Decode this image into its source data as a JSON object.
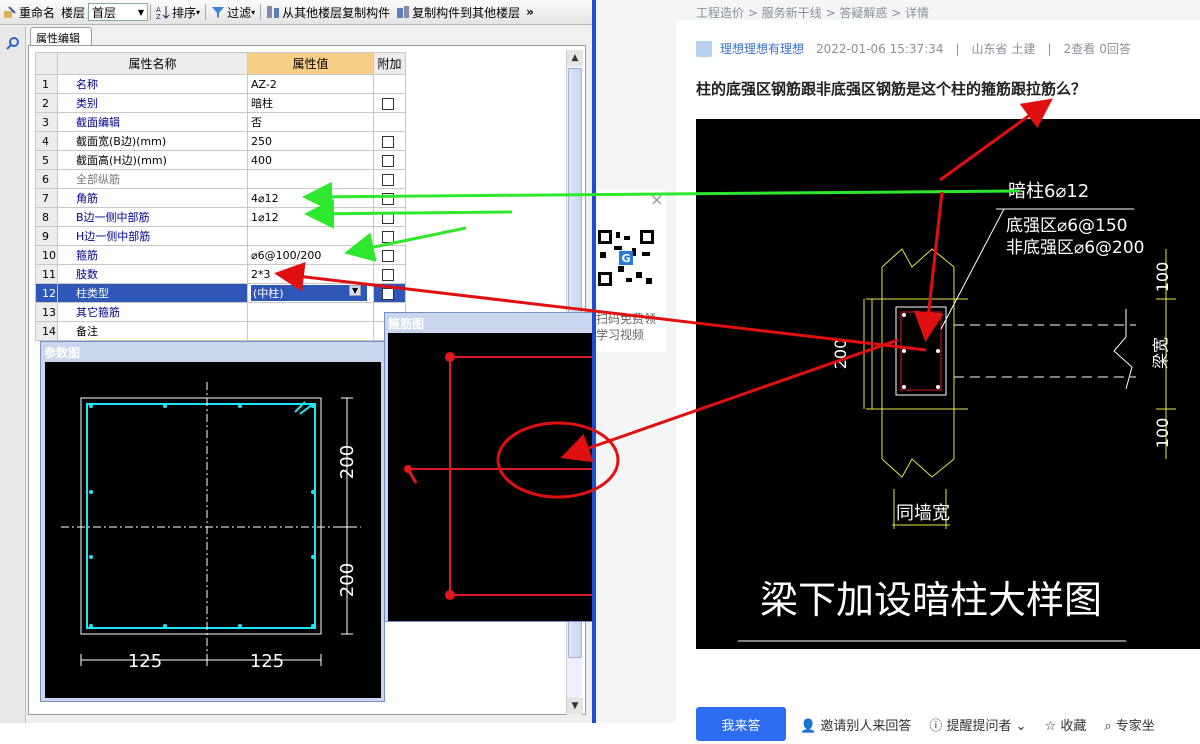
{
  "toolbar": {
    "rename": "重命名",
    "floor_label": "楼层",
    "floor_value": "首层",
    "sort": "排序",
    "filter": "过滤",
    "copy_from": "从其他楼层复制构件",
    "copy_to": "复制构件到其他楼层",
    "more": "»"
  },
  "tab": "属性编辑",
  "grid": {
    "headers": [
      "属性名称",
      "属性值",
      "附加"
    ],
    "rows": [
      {
        "no": "1",
        "name": "名称",
        "value": "AZ-2",
        "cb": false,
        "cls": ""
      },
      {
        "no": "2",
        "name": "类别",
        "value": "暗柱",
        "cb": true,
        "cls": ""
      },
      {
        "no": "3",
        "name": "截面编辑",
        "value": "否",
        "cb": false,
        "cls": ""
      },
      {
        "no": "4",
        "name": "截面宽(B边)(mm)",
        "value": "250",
        "cb": true,
        "cls": "blk"
      },
      {
        "no": "5",
        "name": "截面高(H边)(mm)",
        "value": "400",
        "cb": true,
        "cls": "blk"
      },
      {
        "no": "6",
        "name": "全部纵筋",
        "value": "",
        "cb": true,
        "cls": "gray"
      },
      {
        "no": "7",
        "name": "角筋",
        "value": "4⌀12",
        "cb": true,
        "cls": ""
      },
      {
        "no": "8",
        "name": "B边一侧中部筋",
        "value": "1⌀12",
        "cb": true,
        "cls": ""
      },
      {
        "no": "9",
        "name": "H边一侧中部筋",
        "value": "",
        "cb": true,
        "cls": ""
      },
      {
        "no": "10",
        "name": "箍筋",
        "value": "⌀6@100/200",
        "cb": true,
        "cls": ""
      },
      {
        "no": "11",
        "name": "肢数",
        "value": "2*3",
        "cb": true,
        "cls": ""
      },
      {
        "no": "12",
        "name": "柱类型",
        "value": "(中柱)",
        "cb": true,
        "cls": "sel"
      },
      {
        "no": "13",
        "name": "其它箍筋",
        "value": "",
        "cb": false,
        "cls": ""
      },
      {
        "no": "14",
        "name": "备注",
        "value": "",
        "cb": false,
        "cls": "blk"
      }
    ]
  },
  "param_panel": {
    "title": "参数图",
    "dim_top": "200",
    "dim_bottom": "200",
    "dim_left": "125",
    "dim_right": "125"
  },
  "rebar_panel": {
    "title": "箍筋图"
  },
  "qr": {
    "line1": "扫码免费领",
    "line2": "学习视频",
    "close": "×"
  },
  "article": {
    "breadcrumb": "工程造价 > 服务新干线 > 答疑解惑 > 详情",
    "user": "理想理想有理想",
    "datetime": "2022-01-06 15:37:34",
    "location": "山东省",
    "discipline": "土建",
    "views": "2查看",
    "answers": "0回答",
    "title": "柱的底强区钢筋跟非底强区钢筋是这个柱的箍筋跟拉筋么？",
    "cad": {
      "label_main": "暗柱6⌀12",
      "label_strong": "底强区⌀6@150",
      "label_weak": "非底强区⌀6@200",
      "dim_top": "100",
      "dim_bottom": "100",
      "dim_left": "200",
      "beam_width": "梁宽",
      "wall_width": "同墙宽",
      "caption": "梁下加设暗柱大样图"
    },
    "actions": {
      "answer": "我来答",
      "invite": "邀请别人来回答",
      "remind": "提醒提问者",
      "favorite": "收藏",
      "expert": "专家坐"
    }
  }
}
